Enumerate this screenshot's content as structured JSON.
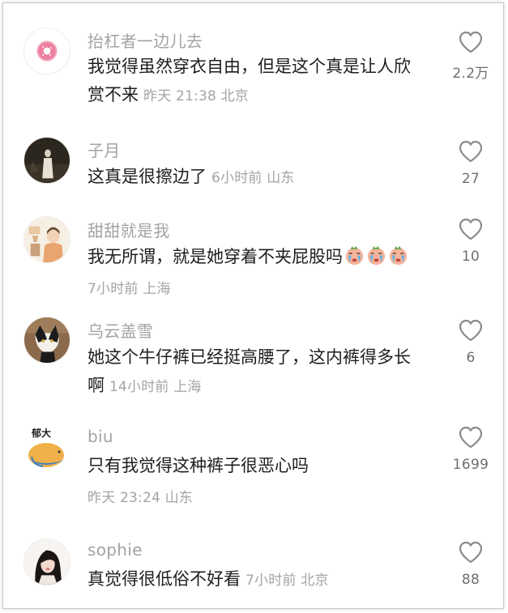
{
  "comments": [
    {
      "username": "抬杠者一边儿去",
      "text_line1": "我觉得虽然穿衣自由，但是这个真是让人欣",
      "text_line2": "赏不来",
      "meta": "昨天 21:38 北京",
      "likes": "2.2万",
      "avatar_icon": "donut-avatar"
    },
    {
      "username": "子月",
      "text": "这真是很擦边了",
      "meta": "6小时前 山东",
      "likes": "27",
      "avatar_icon": "dark-photo-avatar"
    },
    {
      "username": "甜甜就是我",
      "text": "我无所谓，就是她穿着不夹屁股吗",
      "emoji_icon": "crying-face-emoji",
      "emoji_count": 3,
      "meta": "7小时前 上海",
      "likes": "10",
      "avatar_icon": "illustration-avatar"
    },
    {
      "username": "乌云盖雪",
      "text_line1": "她这个牛仔裤已经挺高腰了，这内裤得多长",
      "text_line2": "啊",
      "meta": "14小时前 上海",
      "likes": "6",
      "avatar_icon": "cat-avatar"
    },
    {
      "username": "biu",
      "text": "只有我觉得这种裤子很恶心吗",
      "meta": "昨天 23:24 山东",
      "likes": "1699",
      "avatar_icon": "cartoon-avatar",
      "avatar_label": "郁大"
    },
    {
      "username": "sophie",
      "text": "真觉得很低俗不好看",
      "meta": "7小时前 北京",
      "likes": "88",
      "avatar_icon": "portrait-avatar"
    }
  ],
  "colors": {
    "username": "#a3a3a3",
    "text": "#1e1e1e",
    "meta": "#a3a3a3",
    "like_icon": "#8a8a8a"
  }
}
